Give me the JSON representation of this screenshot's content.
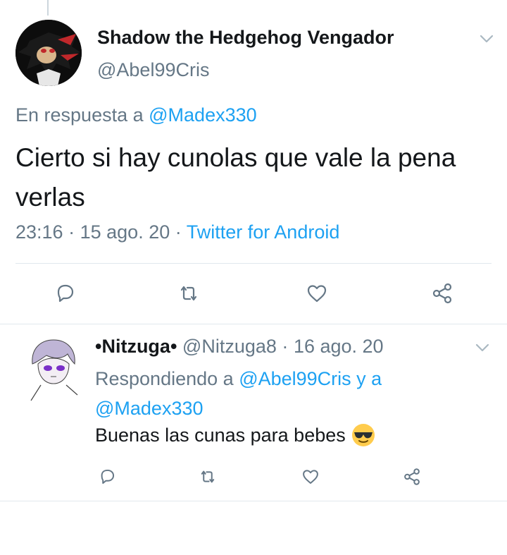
{
  "main_tweet": {
    "display_name": "Shadow the Hedgehog Vengador",
    "handle": "@Abel99Cris",
    "reply_prefix": "En respuesta a",
    "reply_to": "@Madex330",
    "text": "Cierto si hay cunolas que vale la pena verlas",
    "time": "23:16",
    "separator1": "·",
    "date": "15 ago. 20",
    "separator2": "·",
    "source": "Twitter for Android"
  },
  "reply_tweet": {
    "display_name": "•Nitzuga•",
    "handle": "@Nitzuga8",
    "separator": "·",
    "date": "16 ago. 20",
    "replying_prefix": "Respondiendo a",
    "replying_to_1": "@Abel99Cris",
    "replying_joiner": "y a",
    "replying_to_2": "@Madex330",
    "text": "Buenas las cunas para bebes"
  },
  "actions": {
    "icons": [
      "reply-icon",
      "retweet-icon",
      "like-icon",
      "share-icon"
    ]
  },
  "colors": {
    "link": "#1da1f2",
    "secondary": "#657786",
    "primary_text": "#14171a",
    "divider": "#e1e8ed",
    "icon": "#657786"
  }
}
